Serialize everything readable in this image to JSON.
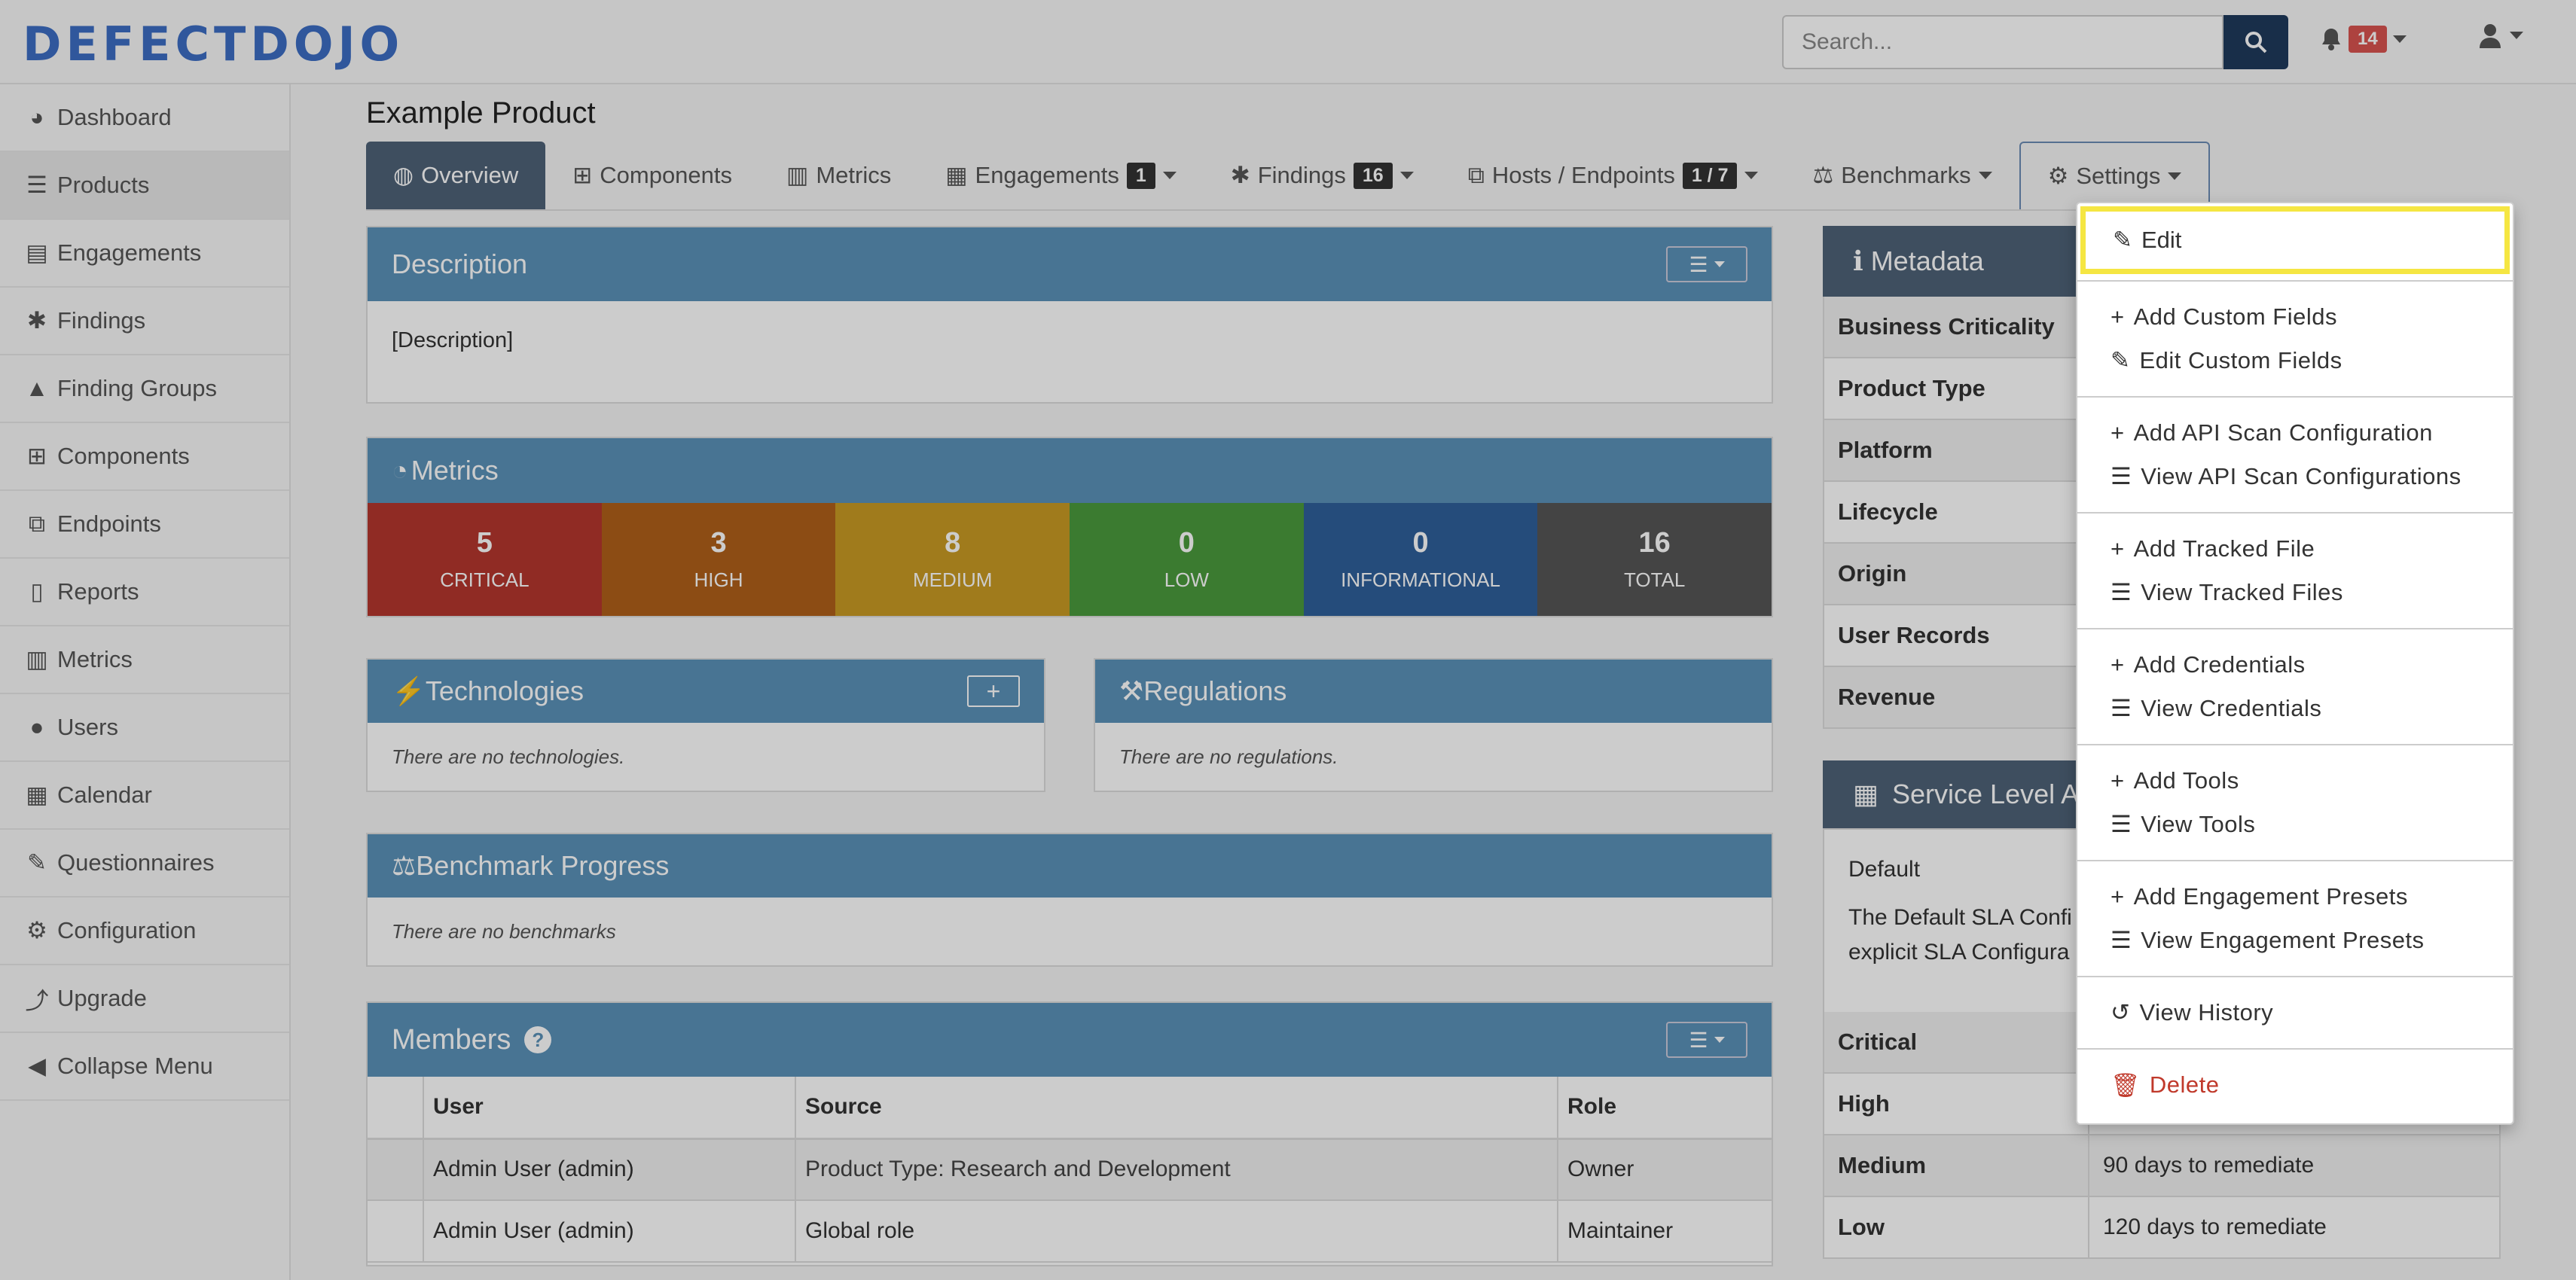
{
  "app": {
    "logo": "DEFECTDOJO"
  },
  "search": {
    "placeholder": "Search..."
  },
  "notifications": {
    "count": "14"
  },
  "sidebar": {
    "items": [
      {
        "label": "Dashboard",
        "icon": "dashboard-icon"
      },
      {
        "label": "Products",
        "icon": "list-icon"
      },
      {
        "label": "Engagements",
        "icon": "inbox-icon"
      },
      {
        "label": "Findings",
        "icon": "bug-icon"
      },
      {
        "label": "Finding Groups",
        "icon": "warning-icon"
      },
      {
        "label": "Components",
        "icon": "table-icon"
      },
      {
        "label": "Endpoints",
        "icon": "sitemap-icon"
      },
      {
        "label": "Reports",
        "icon": "file-icon"
      },
      {
        "label": "Metrics",
        "icon": "chart-icon"
      },
      {
        "label": "Users",
        "icon": "user-icon"
      },
      {
        "label": "Calendar",
        "icon": "calendar-icon"
      },
      {
        "label": "Questionnaires",
        "icon": "questionnaire-icon"
      },
      {
        "label": "Configuration",
        "icon": "gear-icon"
      },
      {
        "label": "Upgrade",
        "icon": "upgrade-icon"
      },
      {
        "label": "Collapse Menu",
        "icon": "collapse-icon"
      }
    ]
  },
  "page": {
    "title": "Example Product"
  },
  "tabs": [
    {
      "label": "Overview"
    },
    {
      "label": "Components"
    },
    {
      "label": "Metrics"
    },
    {
      "label": "Engagements",
      "badge": "1"
    },
    {
      "label": "Findings",
      "badge": "16"
    },
    {
      "label": "Hosts / Endpoints",
      "badge": "1 / 7"
    },
    {
      "label": "Benchmarks"
    },
    {
      "label": "Settings"
    }
  ],
  "description": {
    "title": "Description",
    "text": "[Description]"
  },
  "metrics": {
    "title": "Metrics",
    "cells": [
      {
        "value": "5",
        "label": "CRITICAL",
        "color": "#b5362e"
      },
      {
        "value": "3",
        "label": "HIGH",
        "color": "#b0601a"
      },
      {
        "value": "8",
        "label": "MEDIUM",
        "color": "#c99a23"
      },
      {
        "value": "0",
        "label": "LOW",
        "color": "#4a9a3c"
      },
      {
        "value": "0",
        "label": "INFORMATIONAL",
        "color": "#2f5f9a"
      },
      {
        "value": "16",
        "label": "TOTAL",
        "color": "#555555"
      }
    ]
  },
  "technologies": {
    "title": "Technologies",
    "empty": "There are no technologies."
  },
  "regulations": {
    "title": "Regulations",
    "empty": "There are no regulations."
  },
  "benchmark": {
    "title": "Benchmark Progress",
    "empty": "There are no benchmarks"
  },
  "members": {
    "title": "Members",
    "columns": [
      "User",
      "Source",
      "Role"
    ],
    "rows": [
      {
        "user": "Admin User (admin)",
        "source": "Product Type: Research and Development",
        "role": "Owner"
      },
      {
        "user": "Admin User (admin)",
        "source": "Global role",
        "role": "Maintainer"
      }
    ]
  },
  "metadata": {
    "title": "Metadata",
    "rows": [
      "Business Criticality",
      "Product Type",
      "Platform",
      "Lifecycle",
      "Origin",
      "User Records",
      "Revenue"
    ]
  },
  "sla": {
    "title": "Service Level A",
    "name": "Default",
    "text_line1": "The Default SLA Confi",
    "text_line2": "explicit SLA Configura",
    "rows": [
      {
        "k": "Critical",
        "v": ""
      },
      {
        "k": "High",
        "v": ""
      },
      {
        "k": "Medium",
        "v": "90 days to remediate"
      },
      {
        "k": "Low",
        "v": "120 days to remediate"
      }
    ]
  },
  "settings_menu": {
    "edit": "Edit",
    "groups": [
      [
        {
          "label": "Add Custom Fields",
          "icon": "plus-icon"
        },
        {
          "label": "Edit Custom Fields",
          "icon": "edit-icon"
        }
      ],
      [
        {
          "label": "Add API Scan Configuration",
          "icon": "plus-icon"
        },
        {
          "label": "View API Scan Configurations",
          "icon": "list-icon"
        }
      ],
      [
        {
          "label": "Add Tracked File",
          "icon": "plus-icon"
        },
        {
          "label": "View Tracked Files",
          "icon": "list-icon"
        }
      ],
      [
        {
          "label": "Add Credentials",
          "icon": "plus-icon"
        },
        {
          "label": "View Credentials",
          "icon": "list-icon"
        }
      ],
      [
        {
          "label": "Add Tools",
          "icon": "plus-icon"
        },
        {
          "label": "View Tools",
          "icon": "list-icon"
        }
      ],
      [
        {
          "label": "Add Engagement Presets",
          "icon": "plus-icon"
        },
        {
          "label": "View Engagement Presets",
          "icon": "list-icon"
        }
      ],
      [
        {
          "label": "View History",
          "icon": "history-icon"
        }
      ],
      [
        {
          "label": "Delete",
          "icon": "trash-icon",
          "color": "#c0392b"
        }
      ]
    ]
  }
}
